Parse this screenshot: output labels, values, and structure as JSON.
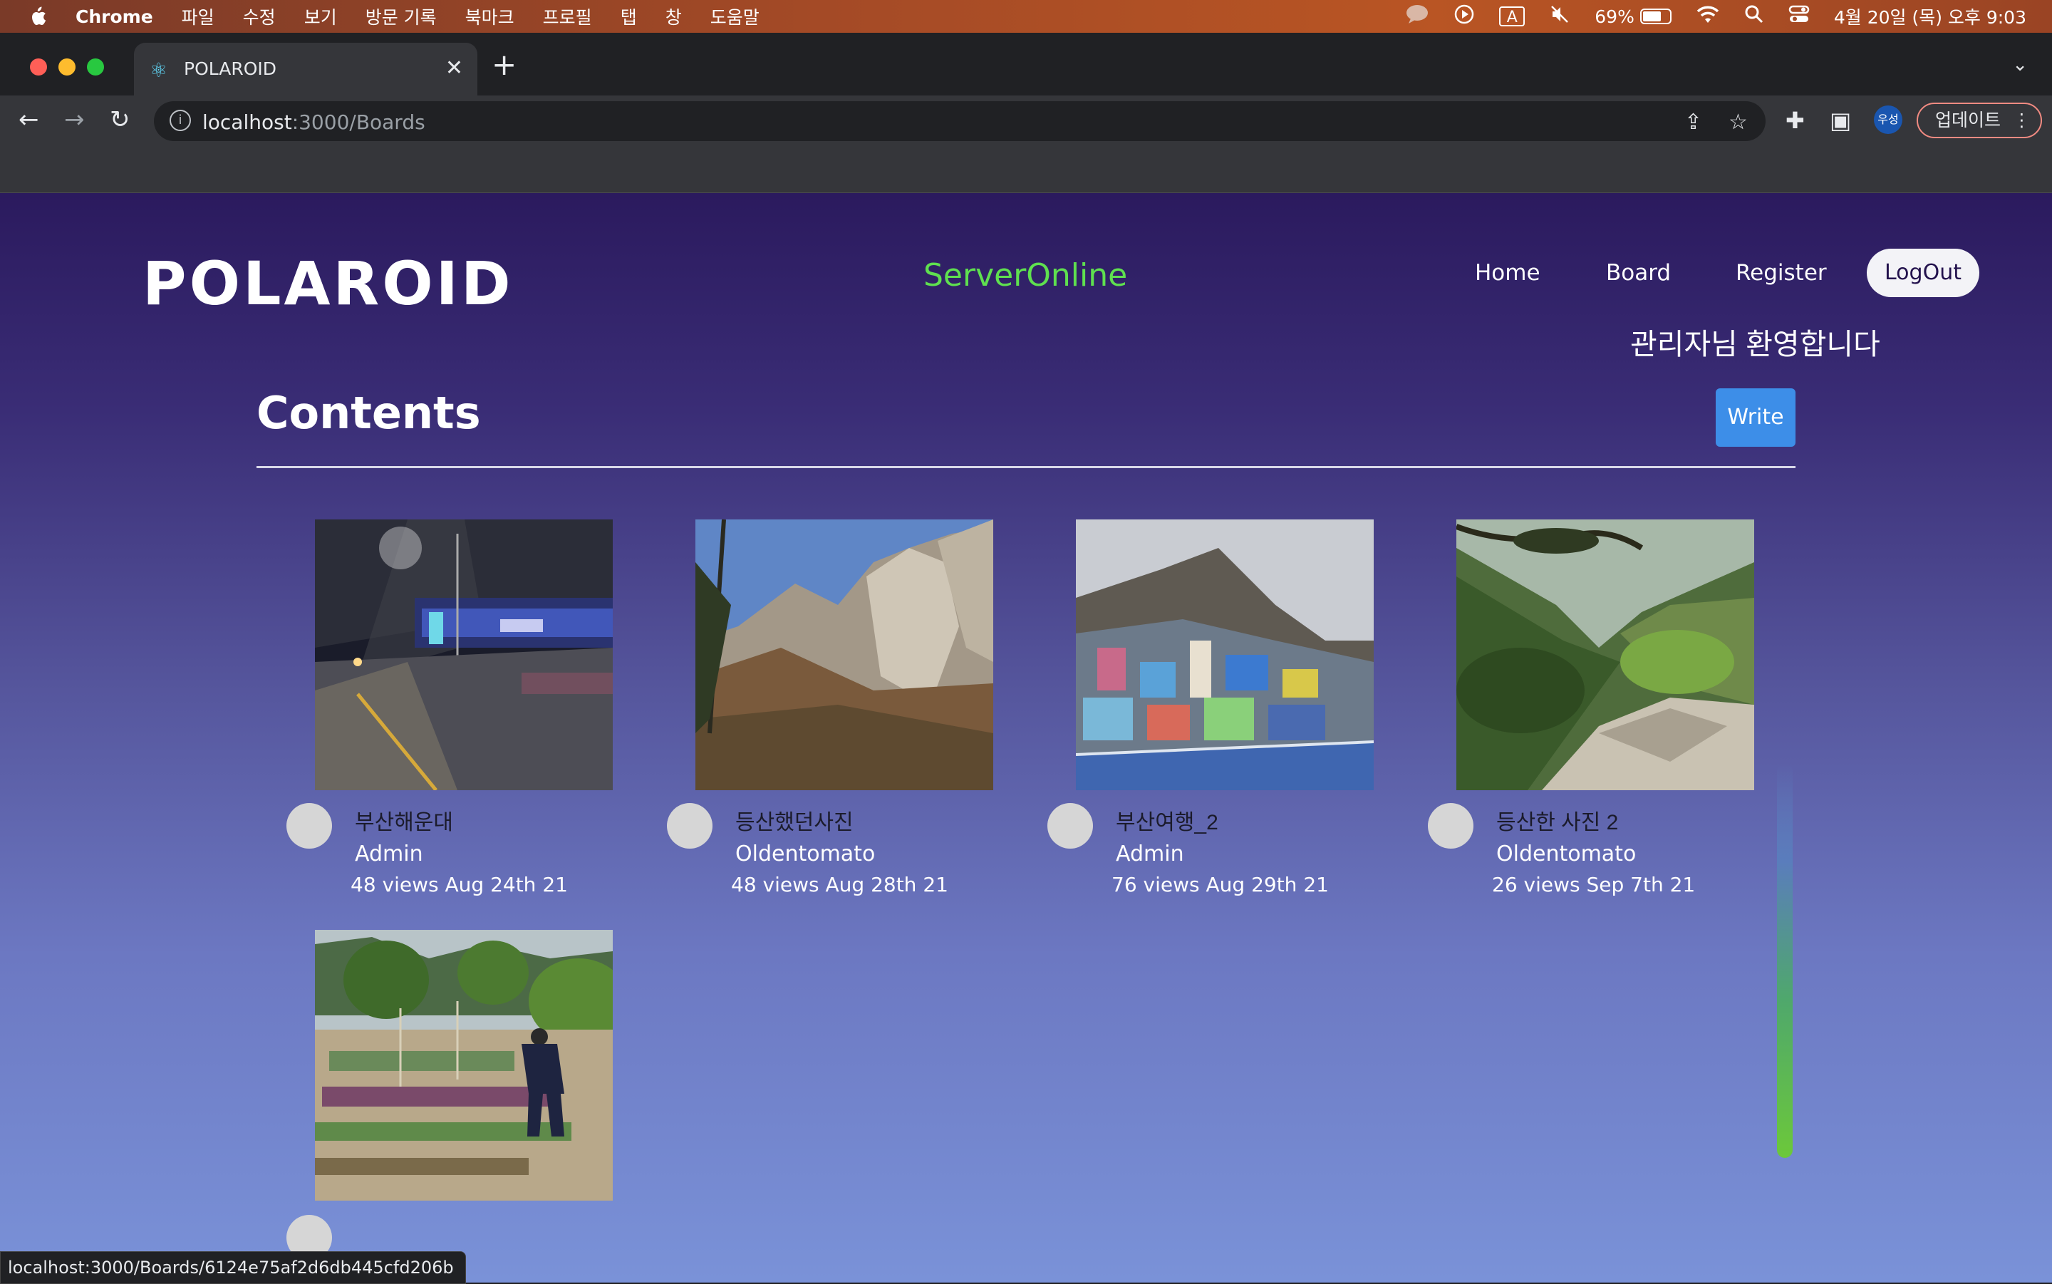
{
  "menubar": {
    "app": "Chrome",
    "items": [
      "파일",
      "수정",
      "보기",
      "방문 기록",
      "북마크",
      "프로필",
      "탭",
      "창",
      "도움말"
    ],
    "input_indicator": "A",
    "battery": "69%",
    "battery_level": 0.69,
    "datetime": "4월 20일 (목) 오후 9:03"
  },
  "browser": {
    "tab_title": "POLAROID",
    "url_host": "localhost",
    "url_path": ":3000/Boards",
    "profile_label": "우성",
    "update_label": "업데이트",
    "status_url": "localhost:3000/Boards/6124e75af2d6db445cfd206b"
  },
  "site": {
    "logo": "POLAROID",
    "server_status": "ServerOnline",
    "server_color": "#5fe04f",
    "nav": [
      "Home",
      "Board",
      "Register"
    ],
    "logout": "LogOut",
    "welcome": "관리자님 환영합니다",
    "section_title": "Contents",
    "write": "Write"
  },
  "posts": [
    {
      "title": "부산해운대",
      "author": "Admin",
      "meta": "48 views Aug 24th 21",
      "image": "night-street-photo"
    },
    {
      "title": "등산했던사진",
      "author": "Oldentomato",
      "meta": "48 views Aug 28th 21",
      "image": "rocky-mountain-photo"
    },
    {
      "title": "부산여행_2",
      "author": "Admin",
      "meta": "76 views Aug 29th 21",
      "image": "hillside-village-photo"
    },
    {
      "title": "등산한 사진 2",
      "author": "Oldentomato",
      "meta": "26 views Sep 7th 21",
      "image": "valley-view-photo"
    },
    {
      "title": "",
      "author": "",
      "meta": "",
      "image": "garden-photo"
    }
  ]
}
